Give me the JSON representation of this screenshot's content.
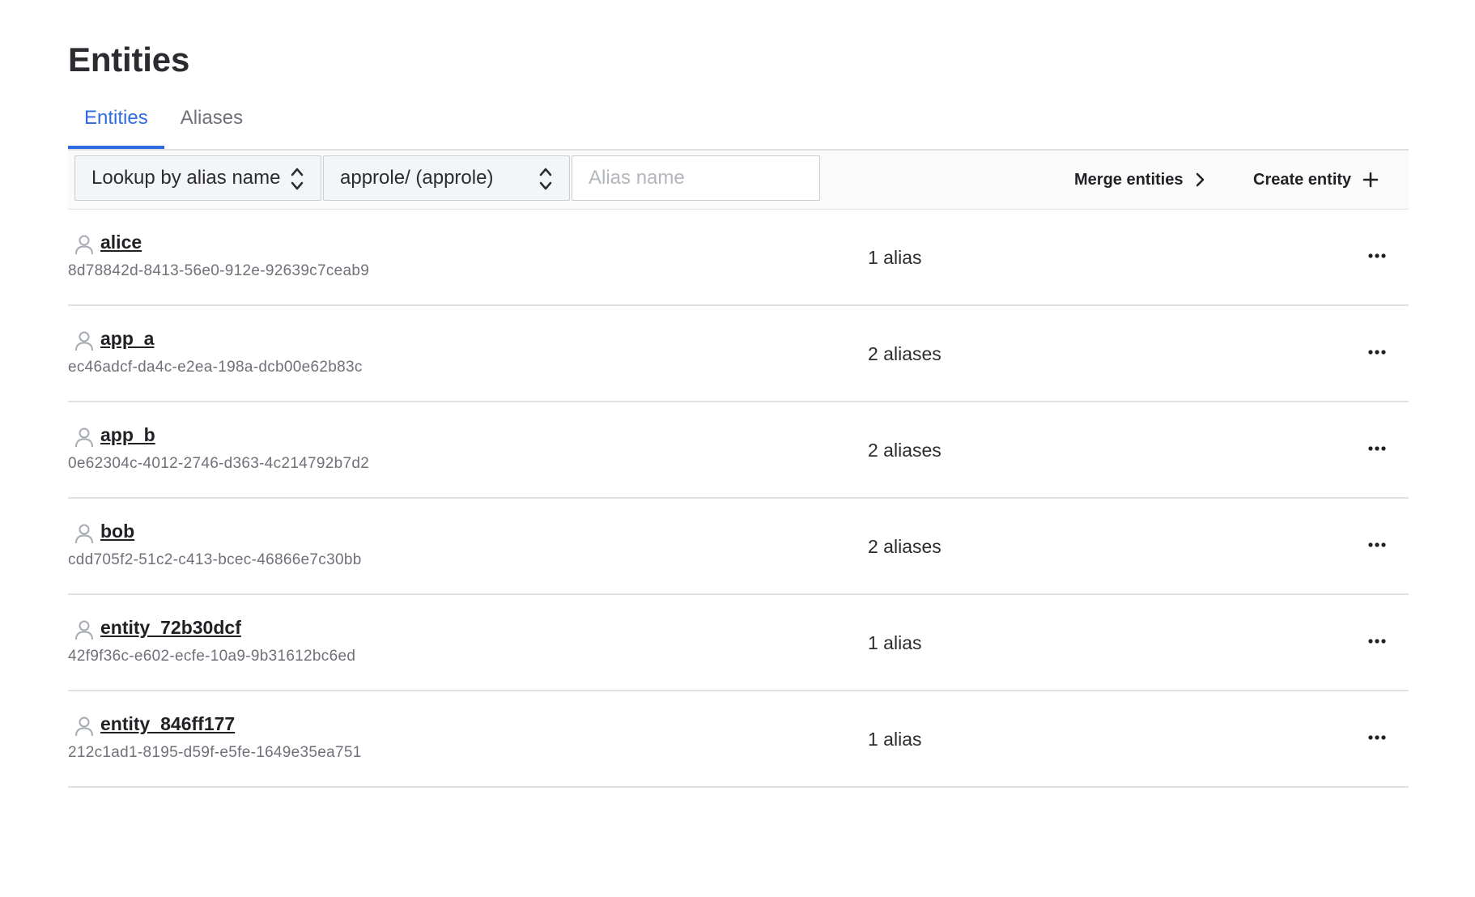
{
  "page": {
    "title": "Entities"
  },
  "tabs": [
    {
      "label": "Entities",
      "active": true
    },
    {
      "label": "Aliases",
      "active": false
    }
  ],
  "toolbar": {
    "lookup_select": "Lookup by alias name",
    "mount_select": "approle/ (approle)",
    "alias_placeholder": "Alias name",
    "merge_label": "Merge entities",
    "create_label": "Create entity"
  },
  "entities": [
    {
      "name": "alice",
      "id": "8d78842d-8413-56e0-912e-92639c7ceab9",
      "aliases": "1 alias"
    },
    {
      "name": "app_a",
      "id": "ec46adcf-da4c-e2ea-198a-dcb00e62b83c",
      "aliases": "2 aliases"
    },
    {
      "name": "app_b",
      "id": "0e62304c-4012-2746-d363-4c214792b7d2",
      "aliases": "2 aliases"
    },
    {
      "name": "bob",
      "id": "cdd705f2-51c2-c413-bcec-46866e7c30bb",
      "aliases": "2 aliases"
    },
    {
      "name": "entity_72b30dcf",
      "id": "42f9f36c-e602-ecfe-10a9-9b31612bc6ed",
      "aliases": "1 alias"
    },
    {
      "name": "entity_846ff177",
      "id": "212c1ad1-8195-d59f-e5fe-1649e35ea751",
      "aliases": "1 alias"
    }
  ],
  "colors": {
    "accent": "#2f6be0",
    "muted": "#6e7178",
    "border": "#dfe1e6"
  }
}
